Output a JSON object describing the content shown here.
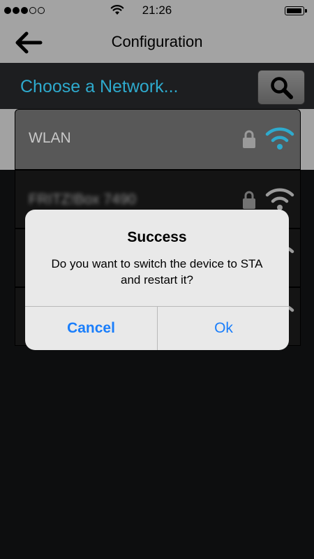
{
  "status_bar": {
    "time": "21:26",
    "signal_filled_dots": 3,
    "signal_total_dots": 5
  },
  "nav": {
    "title": "Configuration",
    "back_icon": "arrow-left-icon"
  },
  "header": {
    "choose_label": "Choose a Network...",
    "search_icon": "search-icon"
  },
  "networks": [
    {
      "name": "WLAN",
      "locked": true,
      "wifi_color": "#2eaacd",
      "selected": true
    },
    {
      "name": "FRITZ!Box 7490",
      "locked": true,
      "wifi_color": "#cfcfcf",
      "selected": false,
      "blurred": true
    }
  ],
  "alert": {
    "title": "Success",
    "message": "Do you want to switch the device to STA and restart it?",
    "cancel_label": "Cancel",
    "ok_label": "Ok"
  },
  "colors": {
    "accent": "#2eaacd",
    "ios_blue": "#1a7efb",
    "bar_gray": "#a3a3a3",
    "background": "#121314"
  }
}
